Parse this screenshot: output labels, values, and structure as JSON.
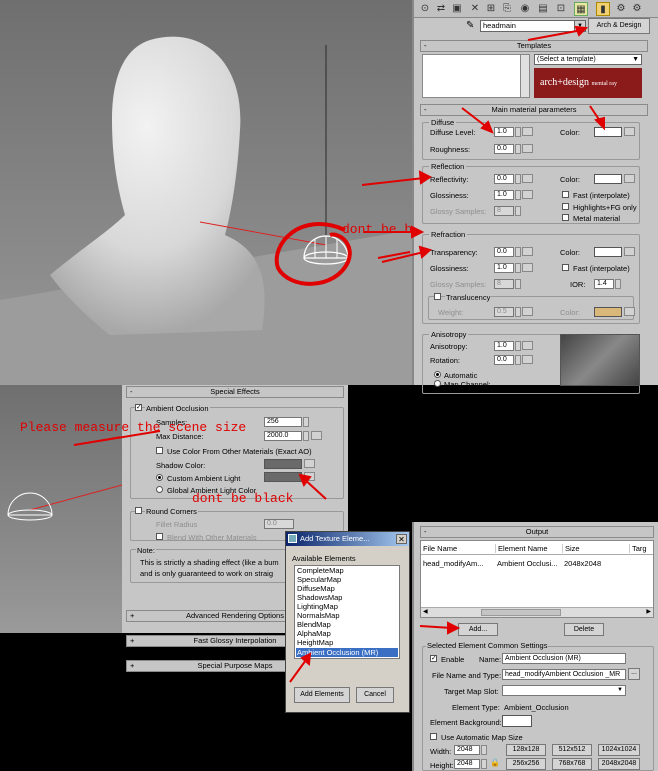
{
  "toolbar": {
    "icons": [
      "pick-icon",
      "put-to-scene-icon",
      "put-to-library-icon",
      "assign-icon",
      "reset-icon",
      "copy-icon",
      "unique-icon",
      "library-icon",
      "material-id-icon",
      "show-map-icon",
      "show-end-icon",
      "go-parent-icon",
      "go-sibling-icon"
    ]
  },
  "material": {
    "name": "headmain",
    "type": "Arch & Design"
  },
  "templates": {
    "header": "Templates",
    "select": "(Select a template)",
    "logo": "arch+design",
    "logo_sub": "mental ray"
  },
  "main_params": {
    "header": "Main material parameters",
    "diffuse": {
      "title": "Diffuse",
      "level_label": "Diffuse Level:",
      "level": "1.0",
      "roughness_label": "Roughness:",
      "roughness": "0.0",
      "color_label": "Color:",
      "color": "#ffffff"
    },
    "reflection": {
      "title": "Reflection",
      "reflectivity_label": "Reflectivity:",
      "reflectivity": "0.0",
      "glossiness_label": "Glossiness:",
      "glossiness": "1.0",
      "glossy_samples_label": "Glossy Samples:",
      "glossy_samples": "8",
      "color_label": "Color:",
      "fast_label": "Fast (interpolate)",
      "highlights_label": "Highlights+FG only",
      "metal_label": "Metal material"
    },
    "refraction": {
      "title": "Refraction",
      "transparency_label": "Transparency:",
      "transparency": "0.0",
      "glossiness_label": "Glossiness:",
      "glossiness": "1.0",
      "glossy_samples_label": "Glossy Samples:",
      "glossy_samples": "8",
      "color_label": "Color:",
      "fast_label": "Fast (interpolate)",
      "ior_label": "IOR:",
      "ior": "1.4",
      "translucency_label": "Translucency",
      "weight_label": "Weight:",
      "weight": "0.5",
      "trans_color_label": "Color:",
      "trans_color": "#d9b87a"
    },
    "anisotropy": {
      "title": "Anisotropy",
      "anisotropy_label": "Anisotropy:",
      "anisotropy": "1.0",
      "rotation_label": "Rotation:",
      "rotation": "0.0",
      "automatic_label": "Automatic",
      "map_channel_label": "Map Channel:"
    }
  },
  "special_effects": {
    "header": "Special Effects",
    "ao_label": "Ambient Occlusion",
    "samples_label": "Samples:",
    "samples": "256",
    "max_distance_label": "Max Distance:",
    "max_distance": "2000.0",
    "use_color_label": "Use Color From Other Materials (Exact AO)",
    "shadow_color_label": "Shadow Color:",
    "custom_ambient_label": "Custom Ambient Light",
    "global_ambient_label": "Global Ambient Light Color",
    "round_corners_label": "Round Corners",
    "fillet_radius_label": "Fillet Radius",
    "fillet_radius": "0.0",
    "blend_label": "Blend With Other Materials",
    "note_title": "Note:",
    "note_line1": "This is strictly a shading effect (like a bum",
    "note_line2": "and is only guaranteed to work on straig",
    "rollouts": [
      "Advanced Rendering Options",
      "Fast Glossy Interpolation",
      "Special Purpose Maps"
    ]
  },
  "dialog": {
    "title": "Add Texture Eleme...",
    "available_label": "Available Elements",
    "elements": [
      "CompleteMap",
      "SpecularMap",
      "DiffuseMap",
      "ShadowsMap",
      "LightingMap",
      "NormalsMap",
      "BlendMap",
      "AlphaMap",
      "HeightMap",
      "Ambient Occlusion (MR)"
    ],
    "selected_index": 9,
    "add_button": "Add Elements",
    "cancel_button": "Cancel"
  },
  "output": {
    "header": "Output",
    "columns": [
      "File Name",
      "Element Name",
      "Size",
      "Targ"
    ],
    "row": {
      "file": "head_modifyAm...",
      "element": "Ambient Occlusi...",
      "size": "2048x2048"
    },
    "add_button": "Add...",
    "delete_button": "Delete",
    "settings_title": "Selected Element Common Settings",
    "enable_label": "Enable",
    "name_label": "Name:",
    "name_value": "Ambient Occlusion (MR)",
    "file_label": "File Name and Type:",
    "file_value": "head_modifyAmbient Occlusion _MR",
    "target_label": "Target Map Slot:",
    "elem_type_label": "Element Type:",
    "elem_type": "Ambient_Occlusion",
    "elem_bg_label": "Element Background:",
    "auto_label": "Use Automatic Map Size",
    "width_label": "Width:",
    "width": "2048",
    "height_label": "Height:",
    "height": "2048",
    "sizes": [
      "128x128",
      "512x512",
      "1024x1024",
      "256x256",
      "768x768",
      "2048x2048"
    ]
  },
  "annotations": {
    "dont_be_black_1": "dont be black",
    "measure": "Please measure the scene size",
    "dont_be_black_2": "dont be black"
  },
  "colors": {
    "panel": "#c6c6c6",
    "annotation": "#e00000",
    "selection": "#3a6fc4",
    "dialog_title": "#0a246a"
  }
}
